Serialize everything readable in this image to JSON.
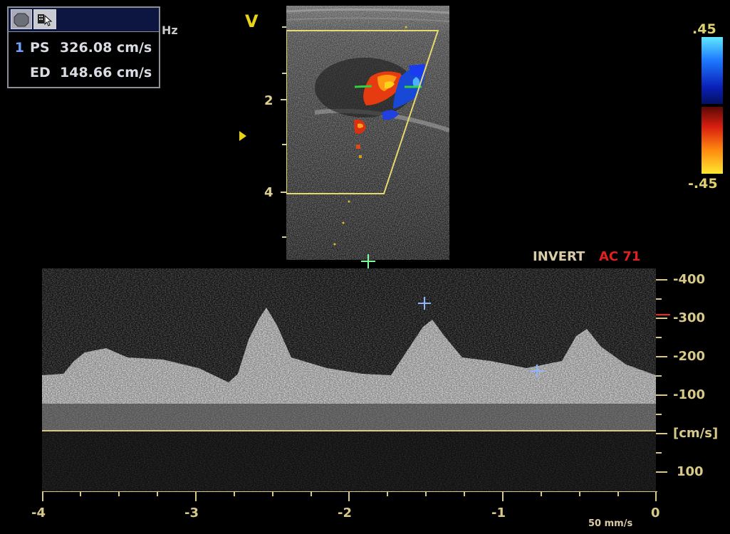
{
  "measurements": {
    "toolbar": {
      "buttons": [
        "record-button",
        "cursor-tool-button"
      ]
    },
    "rows": [
      {
        "index": "1",
        "label": "PS",
        "value": "326.08 cm/s"
      },
      {
        "index": "",
        "label": "ED",
        "value": "148.66 cm/s"
      }
    ],
    "partial_unit": "Hz"
  },
  "bmode": {
    "orientation_marker": "V",
    "depth_labels": [
      "2",
      "4"
    ],
    "color_scale": {
      "top": ".45",
      "bottom": "-.45"
    }
  },
  "doppler": {
    "status": {
      "invert": "INVERT",
      "ac": "AC 71"
    },
    "velocity_ticks": [
      "-400",
      "-300",
      "-200",
      "-100",
      "[cm/s]",
      "100"
    ],
    "time_ticks": [
      "-4",
      "-3",
      "-2",
      "-1",
      "0"
    ],
    "sweep_speed": "50 mm/s"
  },
  "colors": {
    "yellow_marker": "#e8d21a",
    "baseline": "#d8c98a",
    "red_marker": "#ff2020",
    "cursor_blue": "#8fb4ff",
    "cursor_green": "#7dff9a"
  }
}
